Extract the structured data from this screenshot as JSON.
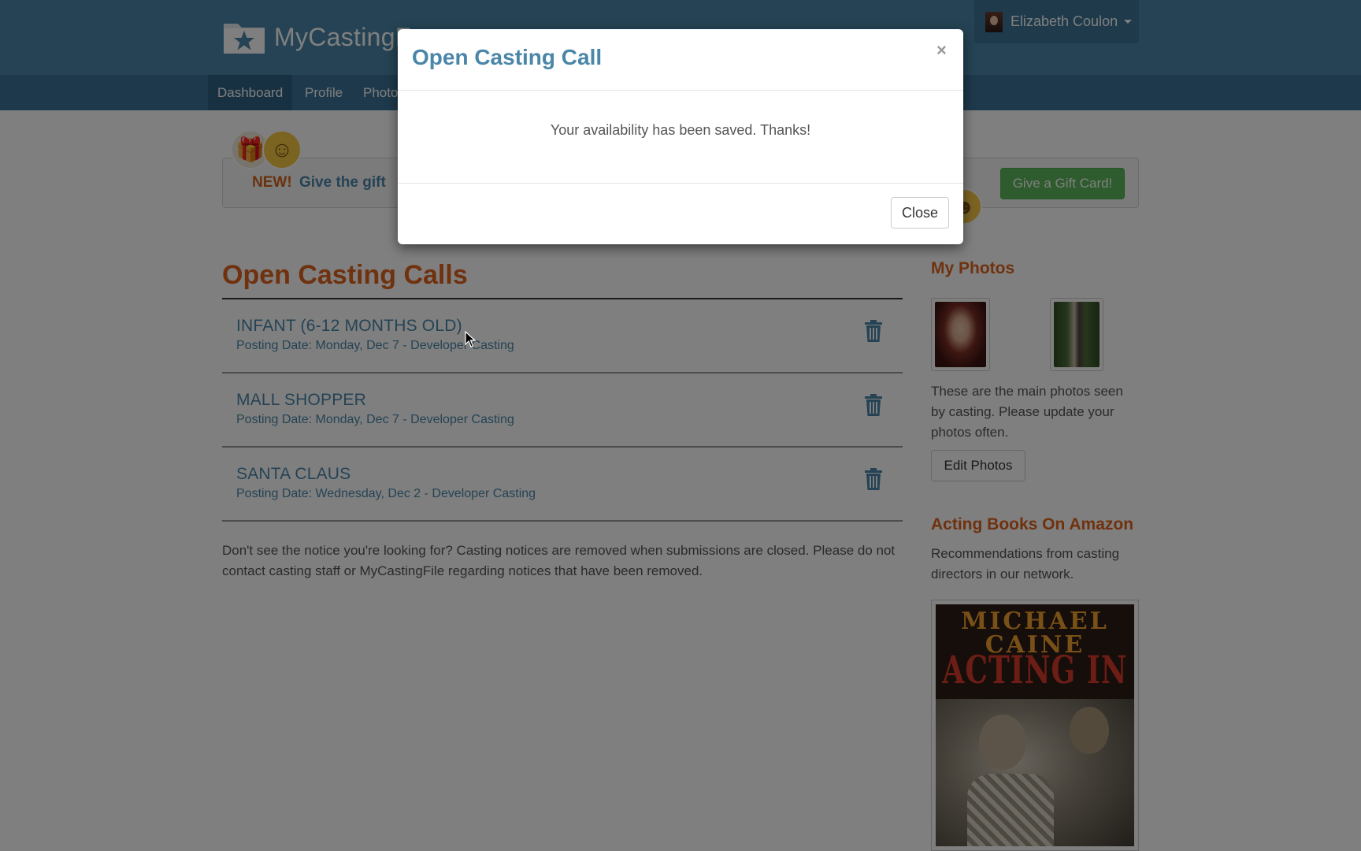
{
  "header": {
    "brand": "MyCastingF",
    "user_name": "Elizabeth Coulon"
  },
  "nav": {
    "items": [
      "Dashboard",
      "Profile",
      "Photo"
    ]
  },
  "promo": {
    "new_label": "NEW!",
    "text": "Give the gift",
    "button": "Give a Gift Card!"
  },
  "main": {
    "title": "Open Casting Calls",
    "calls": [
      {
        "title": "INFANT (6-12 MONTHS OLD)",
        "posting": "Posting Date: Monday, Dec 7 - Developer Casting"
      },
      {
        "title": "MALL SHOPPER",
        "posting": "Posting Date: Monday, Dec 7 - Developer Casting"
      },
      {
        "title": "SANTA CLAUS",
        "posting": "Posting Date: Wednesday, Dec 2 - Developer Casting"
      }
    ],
    "notice": "Don't see the notice you're looking for? Casting notices are removed when submissions are closed. Please do not contact casting staff or MyCastingFile regarding notices that have been removed."
  },
  "sidebar": {
    "photos_title": "My Photos",
    "photos_text": "These are the main photos seen by casting. Please update your photos often.",
    "edit_button": "Edit Photos",
    "books_title": "Acting Books On Amazon",
    "books_text": "Recommendations from casting directors in our network.",
    "book_author_line1": "MICHAEL",
    "book_author_line2": "CAINE",
    "book_title": "ACTING IN FILM"
  },
  "modal": {
    "title": "Open Casting Call",
    "close_x": "×",
    "message": "Your availability has been saved. Thanks!",
    "close_button": "Close"
  },
  "colors": {
    "brand_blue": "#4a86a8",
    "accent_orange": "#e0621d",
    "success_green": "#5cb85c"
  }
}
